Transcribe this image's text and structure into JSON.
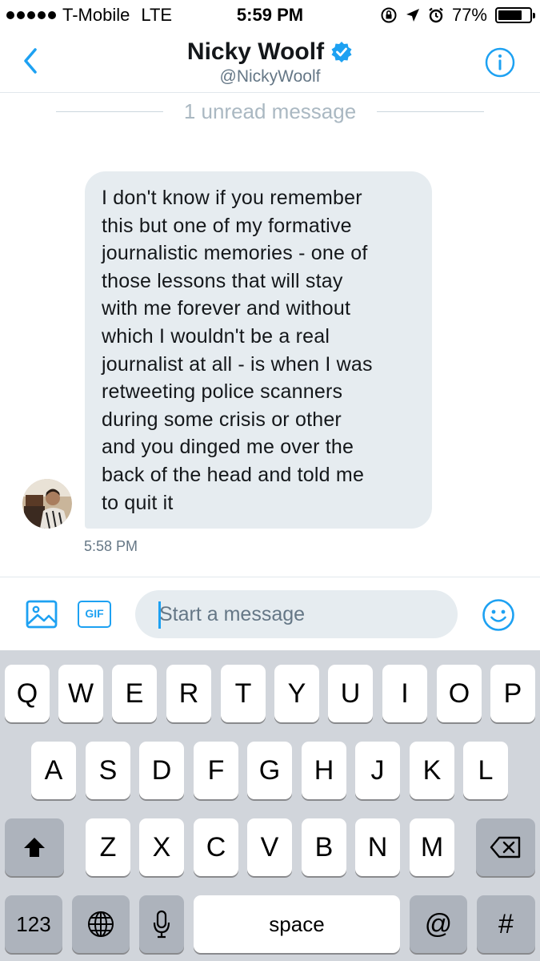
{
  "status_bar": {
    "carrier": "T-Mobile",
    "network": "LTE",
    "time": "5:59 PM",
    "battery_percent": "77%",
    "battery_level": 0.77,
    "icons": [
      "lock-rotation-icon",
      "location-arrow-icon",
      "alarm-icon"
    ]
  },
  "header": {
    "name": "Nicky Woolf",
    "handle": "@NickyWoolf",
    "verified": true,
    "back_icon": "chevron-left-icon",
    "info_icon": "info-icon"
  },
  "unread_divider": "1 unread message",
  "message": {
    "lines": [
      "I don't know if you remember",
      "this but one of my formative",
      "journalistic memories - one of",
      "those lessons that will stay",
      "with me forever and without",
      "which I wouldn't be a real",
      "journalist at all - is when I was",
      "retweeting police scanners",
      "during some crisis or other",
      "and you dinged me over the",
      "back of the head and told me",
      "to quit it"
    ],
    "time": "5:58 PM"
  },
  "composer": {
    "placeholder": "Start a message",
    "gif_label": "GIF",
    "image_icon": "image-icon",
    "emoji_icon": "emoji-icon"
  },
  "keyboard": {
    "row1": [
      "Q",
      "W",
      "E",
      "R",
      "T",
      "Y",
      "U",
      "I",
      "O",
      "P"
    ],
    "row2": [
      "A",
      "S",
      "D",
      "F",
      "G",
      "H",
      "J",
      "K",
      "L"
    ],
    "row3": [
      "Z",
      "X",
      "C",
      "V",
      "B",
      "N",
      "M"
    ],
    "numbers_label": "123",
    "space_label": "space",
    "at_label": "@",
    "hash_label": "#"
  },
  "colors": {
    "accent": "#1da1f2",
    "bubble": "#e6ecf0",
    "keyboard_bg": "#d1d5db"
  }
}
